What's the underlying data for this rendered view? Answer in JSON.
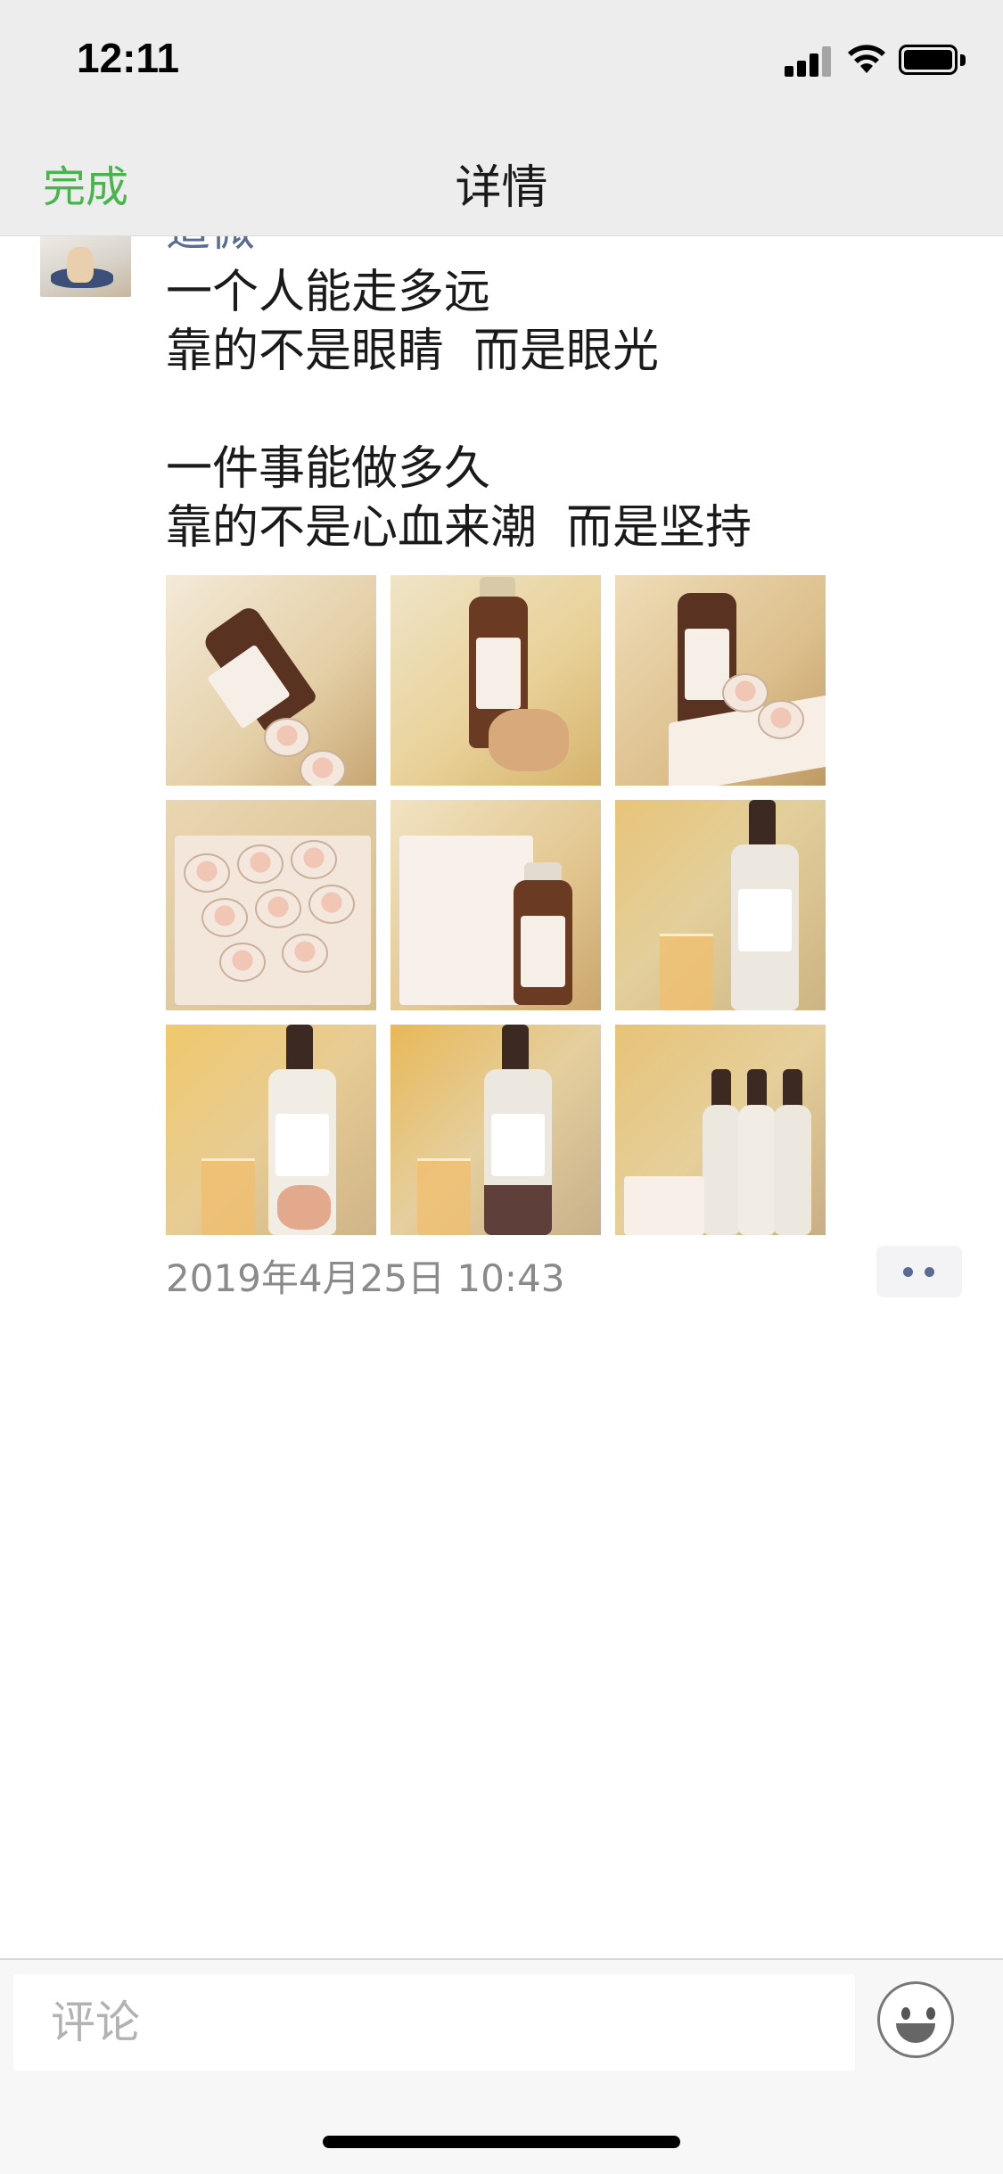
{
  "status_bar": {
    "time": "12:11"
  },
  "nav": {
    "done_label": "完成",
    "title": "详情"
  },
  "post": {
    "username": "道微",
    "text": "一个人能走多远\n靠的不是眼睛  而是眼光\n\n一件事能做多久\n靠的不是心血来潮  而是坚持",
    "photos": [
      {
        "alt": "photo-1"
      },
      {
        "alt": "photo-2"
      },
      {
        "alt": "photo-3"
      },
      {
        "alt": "photo-4"
      },
      {
        "alt": "photo-5"
      },
      {
        "alt": "photo-6"
      },
      {
        "alt": "photo-7"
      },
      {
        "alt": "photo-8"
      },
      {
        "alt": "photo-9"
      }
    ],
    "timestamp": "2019年4月25日 10:43"
  },
  "comment": {
    "placeholder": "评论"
  },
  "colors": {
    "accent_green": "#4ab34e",
    "link_blue": "#576b95",
    "nav_bg": "#ededed"
  },
  "icons": [
    "signal-icon",
    "wifi-icon",
    "battery-icon",
    "more-dots-icon",
    "emoji-icon"
  ]
}
